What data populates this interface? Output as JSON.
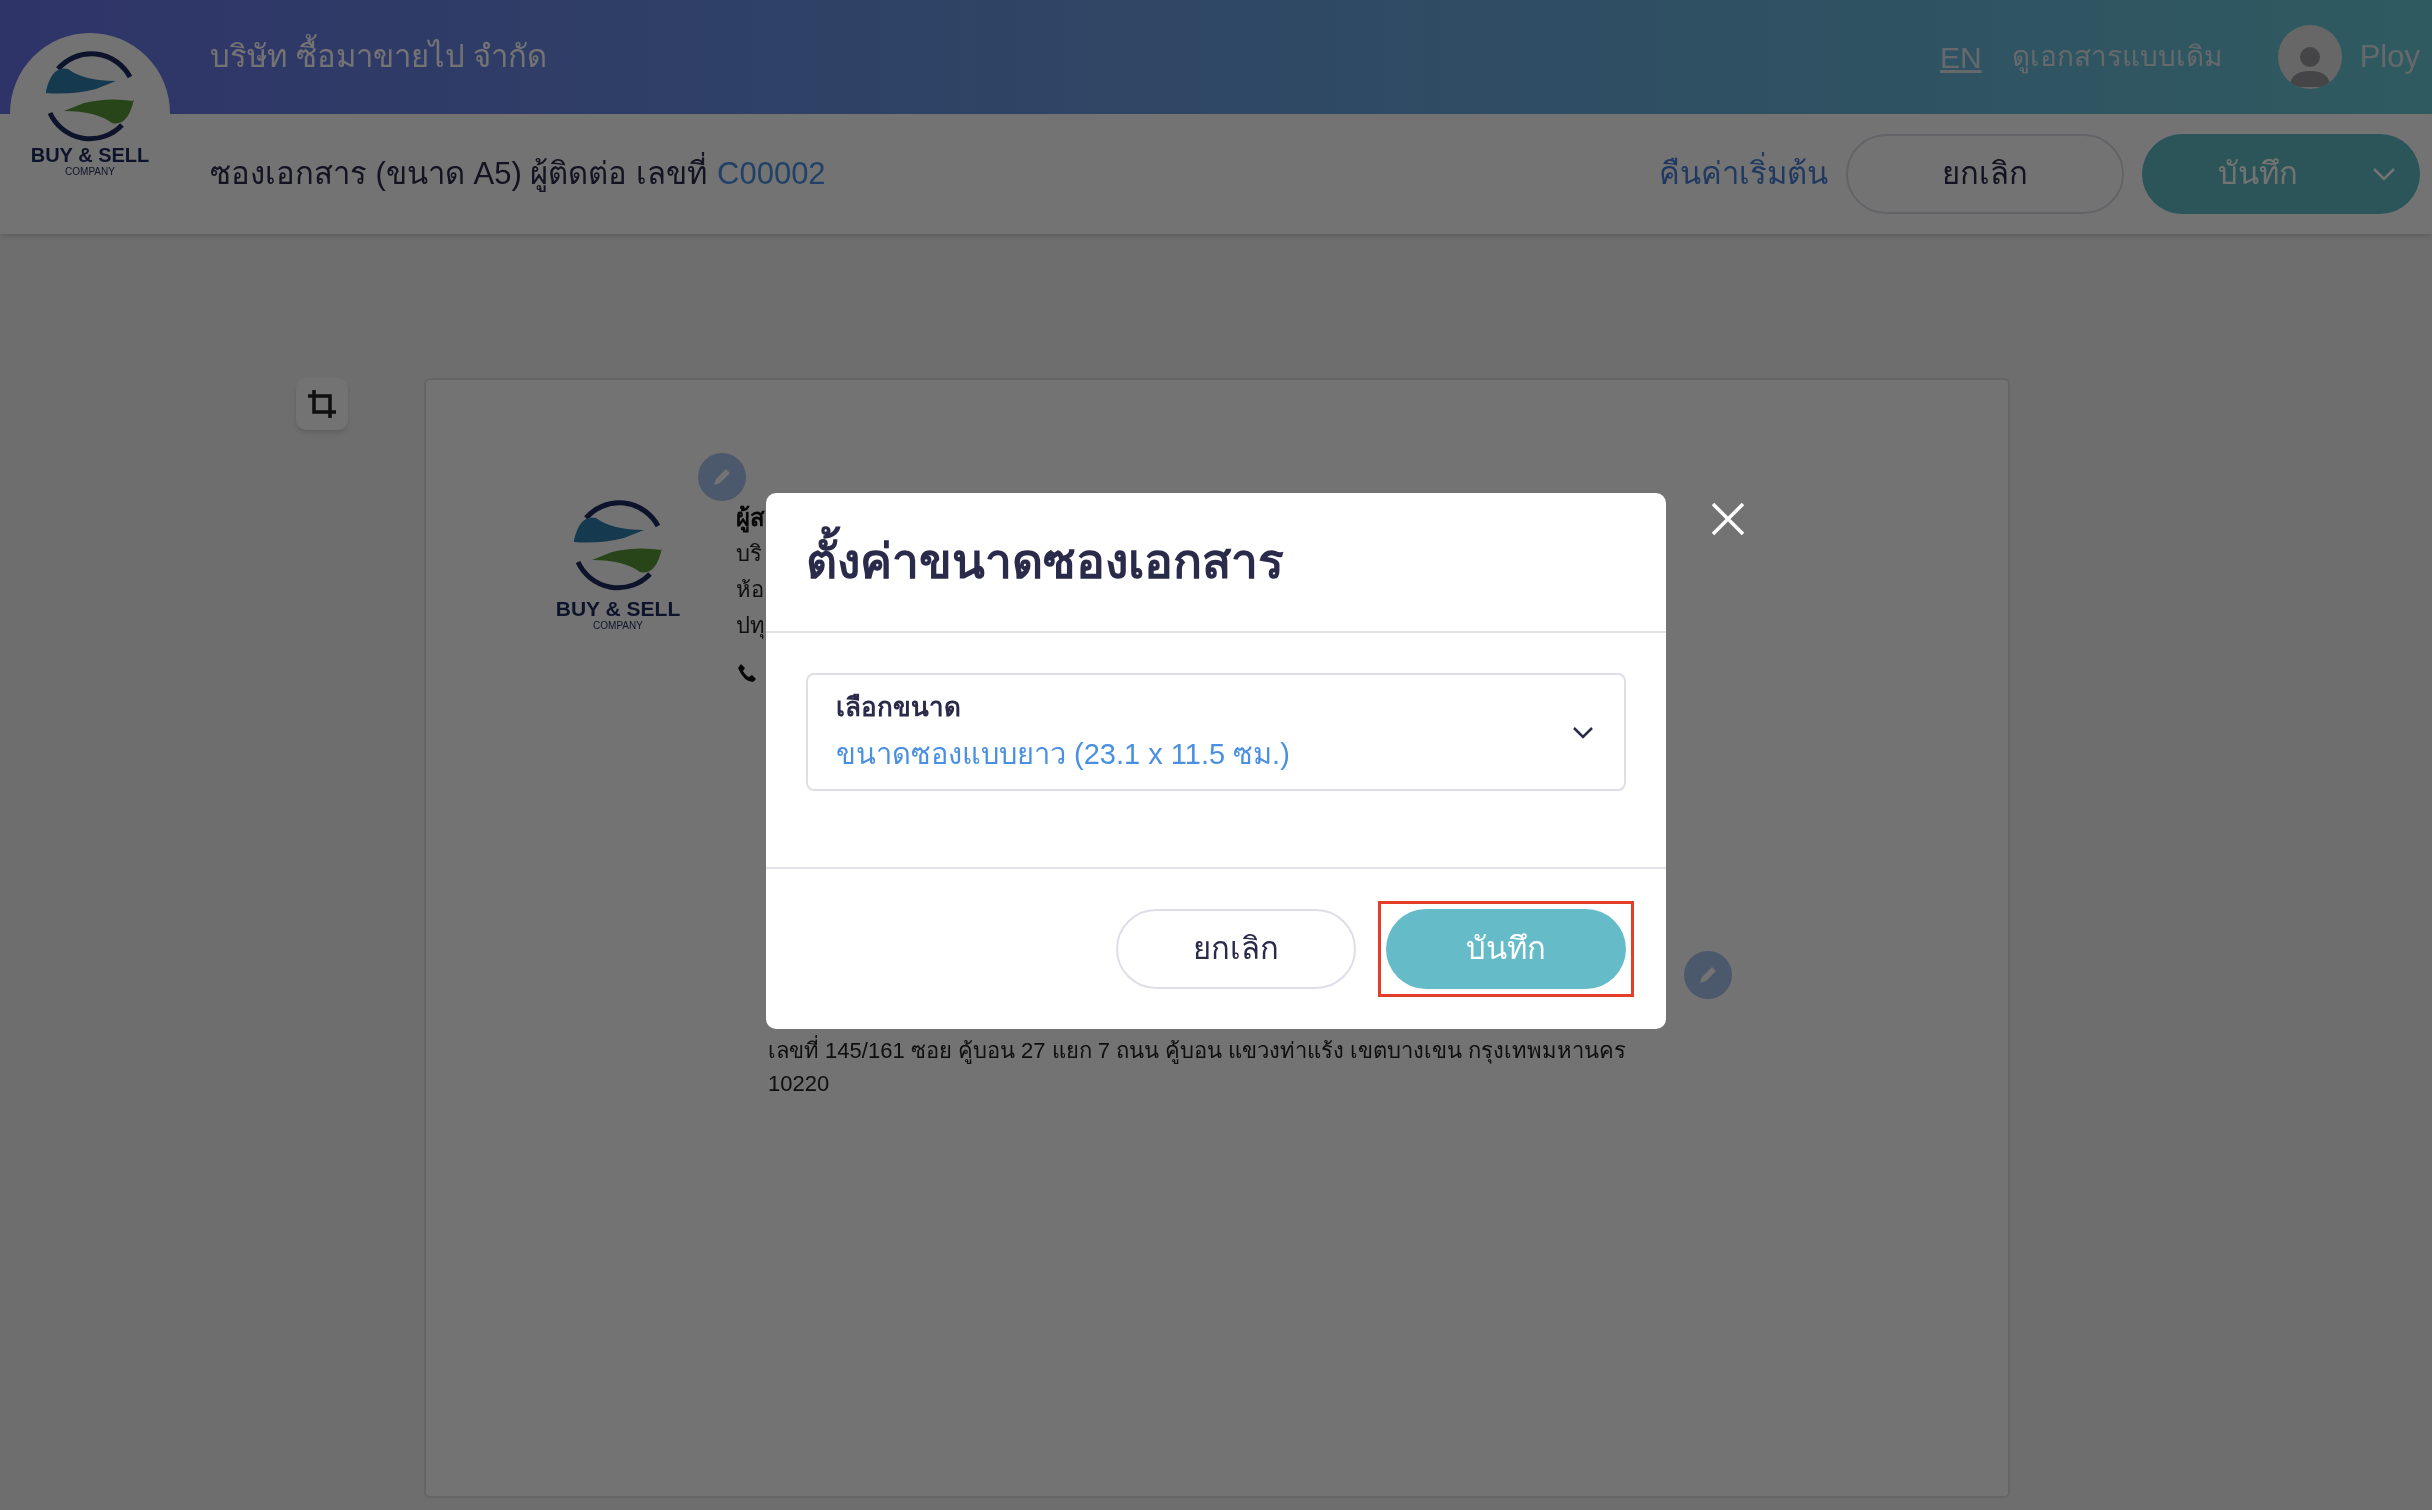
{
  "header": {
    "company_name": "บริษัท ซื้อมาขายไป จำกัด",
    "logo": {
      "name": "BUY & SELL",
      "subtitle": "COMPANY"
    },
    "language_link": "EN",
    "legacy_link": "ดูเอกสารแบบเดิม",
    "user_name": "Ploy"
  },
  "toolbar": {
    "title": "ซองเอกสาร (ขนาด A5) ผู้ติดต่อ เลขที่",
    "document_number": "C00002",
    "reset_link": "คืนค่าเริ่มต้น",
    "cancel_button": "ยกเลิก",
    "save_button": "บันทึก"
  },
  "document": {
    "logo": {
      "name": "BUY & SELL",
      "subtitle": "COMPANY"
    },
    "sender_lines": [
      {
        "text": "ผู้ส",
        "bold": true
      },
      {
        "text": "บริ",
        "bold": false
      },
      {
        "text": "ห้อ",
        "bold": false
      },
      {
        "text": "ปทุ",
        "bold": false
      }
    ],
    "address": "เลขที่ 145/161 ซอย คู้บอน 27 แยก 7 ถนน คู้บอน แขวงท่าแร้ง เขตบางเขน กรุงเทพมหานคร",
    "postcode": "10220"
  },
  "dialog": {
    "title": "ตั้งค่าขนาดซองเอกสาร",
    "size_field": {
      "label": "เลือกขนาด",
      "value": "ขนาดซองแบบยาว (23.1 x 11.5 ซม.)"
    },
    "buttons": [
      {
        "label": "ยกเลิก",
        "kind": "secondary",
        "highlighted": false
      },
      {
        "label": "บันทึก",
        "kind": "primary",
        "highlighted": true
      }
    ]
  }
}
